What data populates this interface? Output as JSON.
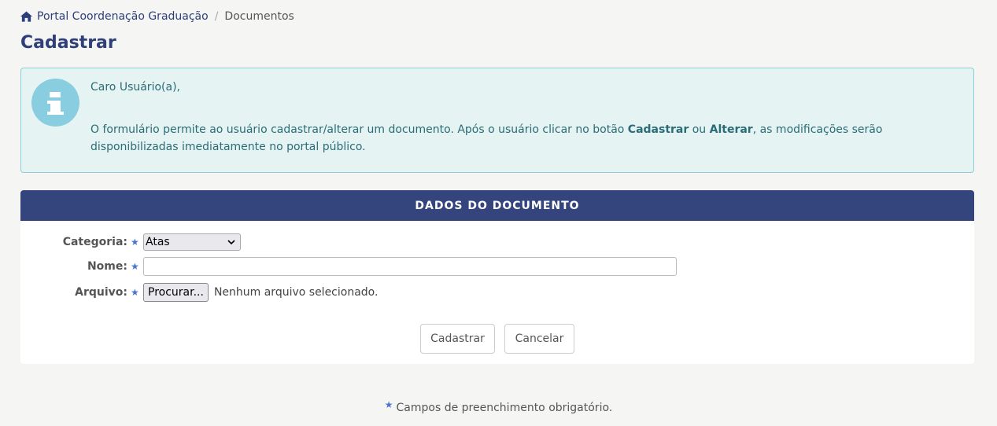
{
  "breadcrumb": {
    "home_label": "Portal Coordenação Graduação",
    "separator": "/",
    "current": "Documentos"
  },
  "page_title": "Cadastrar",
  "info": {
    "greeting": "Caro Usuário(a),",
    "text_part1": "O formulário permite ao usuário cadastrar/alterar um documento. Após o usuário clicar no botão ",
    "bold1": "Cadastrar",
    "text_part2": " ou ",
    "bold2": "Alterar",
    "text_part3": ", as modificações serão disponibilizadas imediatamente no portal público."
  },
  "form": {
    "header": "DADOS DO DOCUMENTO",
    "category_label": "Categoria:",
    "category_value": "Atas",
    "name_label": "Nome:",
    "name_value": "",
    "file_label": "Arquivo:",
    "file_button": "Procurar...",
    "file_status": "Nenhum arquivo selecionado.",
    "required_marker": "★",
    "submit_label": "Cadastrar",
    "cancel_label": "Cancelar"
  },
  "footer": {
    "required_note": "Campos de preenchimento obrigatório."
  },
  "colors": {
    "primary": "#34457e",
    "info_bg": "#e5f3f3",
    "info_border": "#8bcfd6",
    "info_text": "#2a6c77",
    "required_star": "#4a74d0"
  }
}
